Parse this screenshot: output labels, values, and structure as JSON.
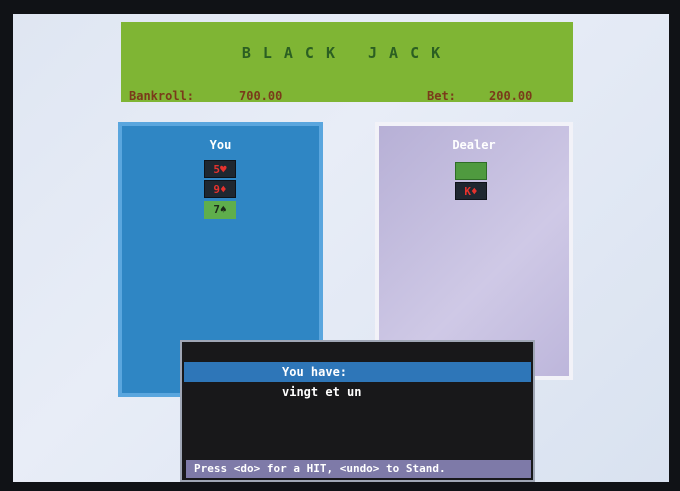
{
  "header": {
    "title": "BLACK JACK",
    "bankroll_label": "Bankroll:",
    "bankroll_value": "700.00",
    "bet_label": "Bet:",
    "bet_value": "200.00"
  },
  "player": {
    "label": "You",
    "cards": [
      {
        "text": "5♥",
        "style": "dark"
      },
      {
        "text": "9♦",
        "style": "dark"
      },
      {
        "text": "7♠",
        "style": "green"
      }
    ]
  },
  "dealer": {
    "label": "Dealer",
    "cards": [
      {
        "text": "",
        "style": "green-back"
      },
      {
        "text": "K♦",
        "style": "dark"
      }
    ]
  },
  "dialog": {
    "heading": "You have:",
    "message": "vingt et un",
    "footer": "Press <do> for a HIT, <undo> to Stand."
  },
  "colors": {
    "header_bg": "#7fb534",
    "player_panel": "#2f86c4",
    "dealer_panel": "#c6bfe0",
    "dialog_bg": "#18181a"
  }
}
